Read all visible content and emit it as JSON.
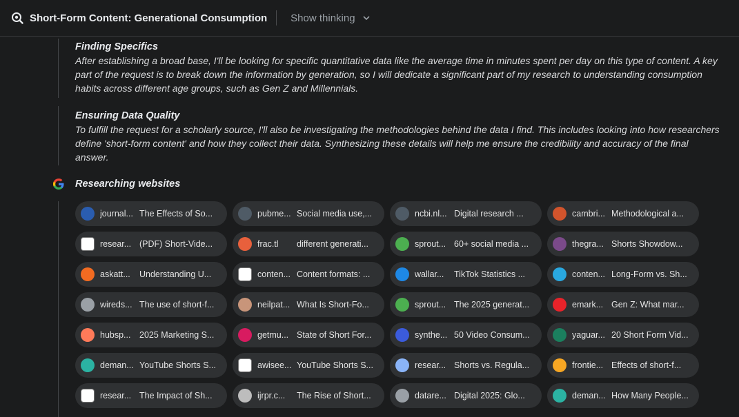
{
  "header": {
    "title": "Short-Form Content: Generational Consumption",
    "show_thinking_label": "Show thinking"
  },
  "thoughts": [
    {
      "heading": "Finding Specifics",
      "body": "After establishing a broad base, I'll be looking for specific quantitative data like the average time in minutes spent per day on this type of content. A key part of the request is to break down the information by generation, so I will dedicate a significant part of my research to understanding consumption habits across different age groups, such as Gen Z and Millennials."
    },
    {
      "heading": "Ensuring Data Quality",
      "body": "To fulfill the request for a scholarly source, I'll also be investigating the methodologies behind the data I find. This includes looking into how researchers define 'short-form content' and how they collect their data. Synthesizing these details will help me ensure the credibility and accuracy of the final answer."
    }
  ],
  "research": {
    "heading": "Researching websites",
    "icon": "google-icon"
  },
  "sources": [
    {
      "src": "journal...",
      "title": "The Effects of So...",
      "icon": "journal-icon",
      "color": "#2a5db0"
    },
    {
      "src": "pubme...",
      "title": "Social media use,...",
      "icon": "pubmed-icon",
      "color": "#4f5b66"
    },
    {
      "src": "ncbi.nl...",
      "title": "Digital research ...",
      "icon": "ncbi-icon",
      "color": "#4f5b66"
    },
    {
      "src": "cambri...",
      "title": "Methodological a...",
      "icon": "cambridge-icon",
      "color": "#d2542c"
    },
    {
      "src": "resear...",
      "title": "(PDF) Short-Vide...",
      "icon": "researchgate-icon",
      "color": "#ffffff"
    },
    {
      "src": "frac.tl",
      "title": "different generati...",
      "icon": "fractl-icon",
      "color": "#e8603c"
    },
    {
      "src": "sprout...",
      "title": "60+ social media ...",
      "icon": "sproutsocial-icon",
      "color": "#4caf50"
    },
    {
      "src": "thegra...",
      "title": "Shorts Showdow...",
      "icon": "thegra-icon",
      "color": "#7b4a8a"
    },
    {
      "src": "askatt...",
      "title": "Understanding U...",
      "icon": "askattest-icon",
      "color": "#f26b21"
    },
    {
      "src": "conten...",
      "title": "Content formats: ...",
      "icon": "contentgrip-icon",
      "color": "#ffffff"
    },
    {
      "src": "wallar...",
      "title": "TikTok Statistics ...",
      "icon": "wallaroo-icon",
      "color": "#1e88e5"
    },
    {
      "src": "conten...",
      "title": "Long-Form vs. Sh...",
      "icon": "contentwriters-icon",
      "color": "#29a8e0"
    },
    {
      "src": "wireds...",
      "title": "The use of short-f...",
      "icon": "wiredspace-icon",
      "color": "#9aa0a6"
    },
    {
      "src": "neilpat...",
      "title": "What Is Short-Fo...",
      "icon": "neilpatel-icon",
      "color": "#c8957a"
    },
    {
      "src": "sprout...",
      "title": "The 2025 generat...",
      "icon": "sproutsocial-icon",
      "color": "#4caf50"
    },
    {
      "src": "emark...",
      "title": "Gen Z: What mar...",
      "icon": "emarketer-icon",
      "color": "#e8232a"
    },
    {
      "src": "hubsp...",
      "title": "2025 Marketing S...",
      "icon": "hubspot-icon",
      "color": "#ff7a59"
    },
    {
      "src": "getmu...",
      "title": "State of Short For...",
      "icon": "getmunch-icon",
      "color": "#d81b60"
    },
    {
      "src": "synthe...",
      "title": "50 Video Consum...",
      "icon": "synthesia-icon",
      "color": "#3b5bdb"
    },
    {
      "src": "yaguar...",
      "title": "20 Short Form Vid...",
      "icon": "yaguara-icon",
      "color": "#1b7f5e"
    },
    {
      "src": "deman...",
      "title": "YouTube Shorts S...",
      "icon": "demandsage-icon",
      "color": "#2bb3a3"
    },
    {
      "src": "awisee...",
      "title": "YouTube Shorts S...",
      "icon": "awisee-icon",
      "color": "#ffffff"
    },
    {
      "src": "resear...",
      "title": "Shorts vs. Regula...",
      "icon": "globe-icon",
      "color": "#8ab4f8"
    },
    {
      "src": "frontie...",
      "title": "Effects of short-f...",
      "icon": "frontiers-icon",
      "color": "#f6a623"
    },
    {
      "src": "resear...",
      "title": "The Impact of Sh...",
      "icon": "researchgate-icon",
      "color": "#ffffff"
    },
    {
      "src": "ijrpr.c...",
      "title": "The Rise of Short...",
      "icon": "ijrpr-icon",
      "color": "#bdbdbd"
    },
    {
      "src": "datare...",
      "title": "Digital 2025: Glo...",
      "icon": "datareportal-icon",
      "color": "#9aa0a6"
    },
    {
      "src": "deman...",
      "title": "How Many People...",
      "icon": "demandsage-icon",
      "color": "#2bb3a3"
    }
  ]
}
